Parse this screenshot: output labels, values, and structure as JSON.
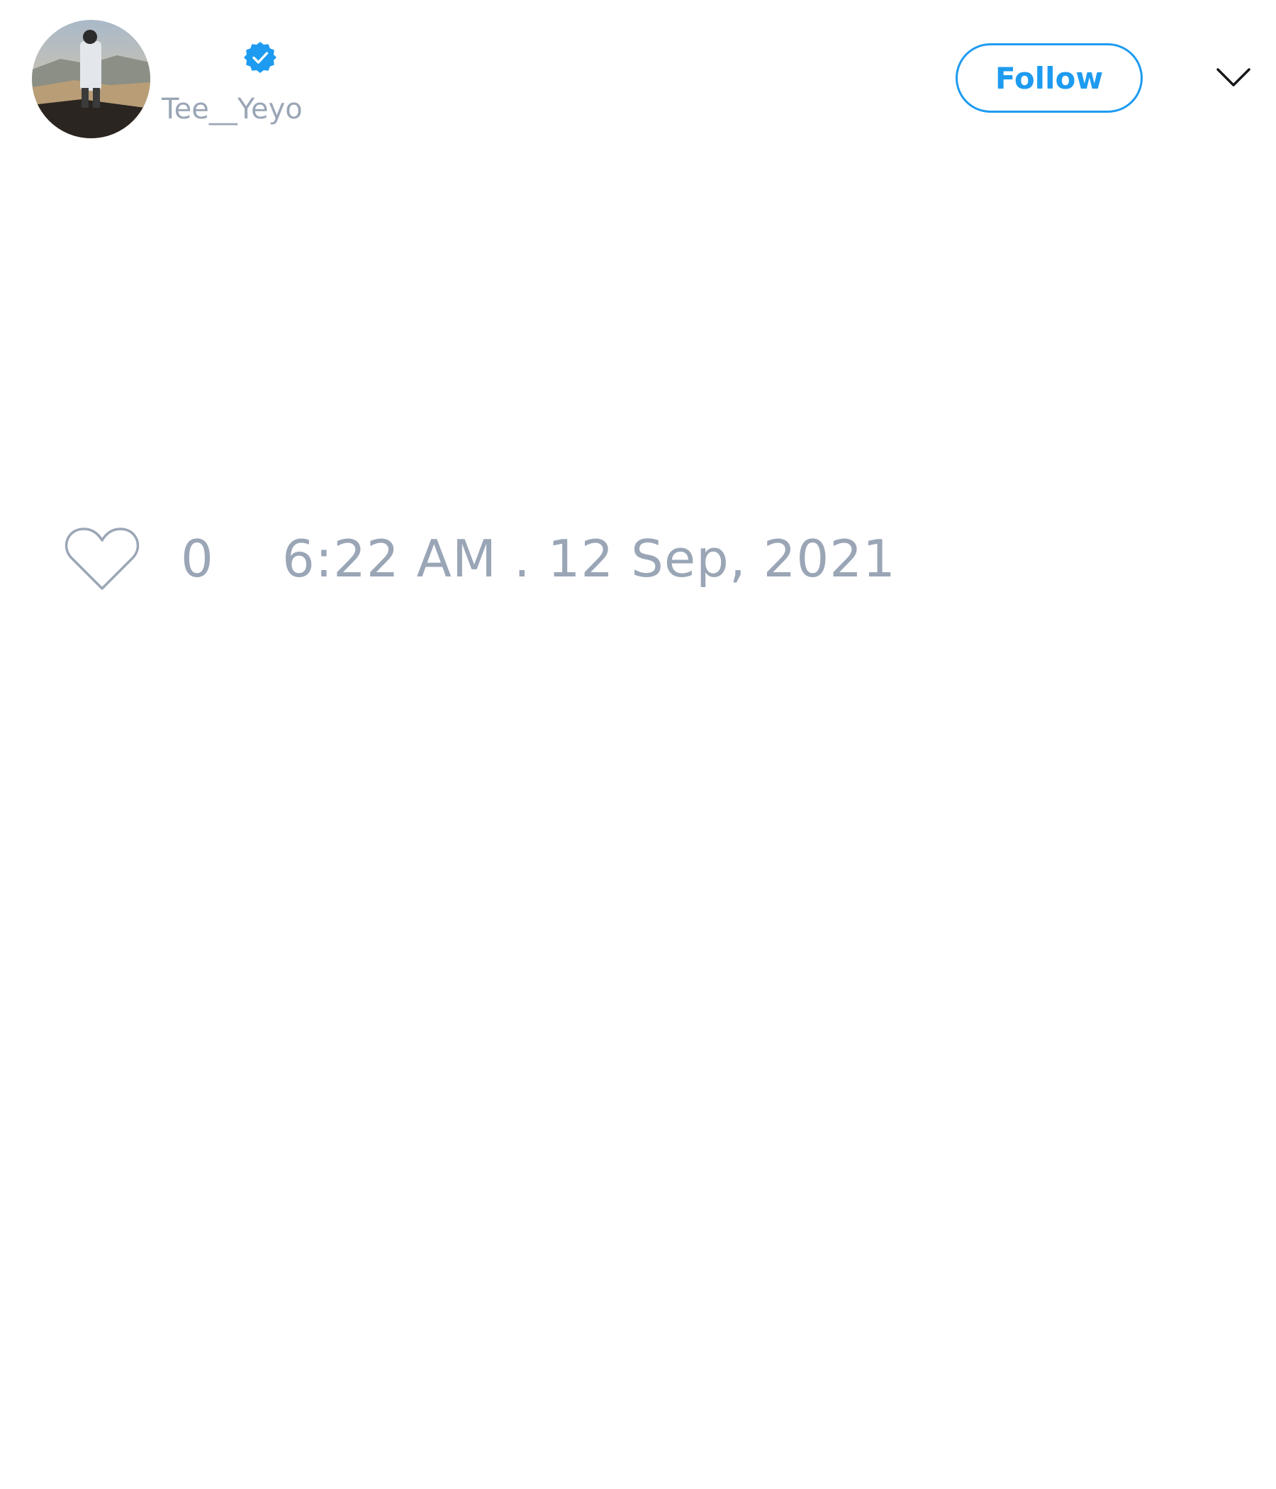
{
  "tweet": {
    "author": {
      "display_name": "",
      "handle": "Tee__Yeyo",
      "verified": true,
      "avatar_icon": "avatar-photo-person-on-cliff"
    },
    "follow_label": "Follow",
    "menu_icon": "chevron-down-icon",
    "like_icon": "heart-outline-icon",
    "like_count": "0",
    "timestamp": "6:22 AM . 12 Sep, 2021"
  },
  "colors": {
    "accent": "#1d9bf0",
    "muted_text": "#9aa6b6",
    "background": "#ffffff",
    "caret": "#14171a"
  }
}
